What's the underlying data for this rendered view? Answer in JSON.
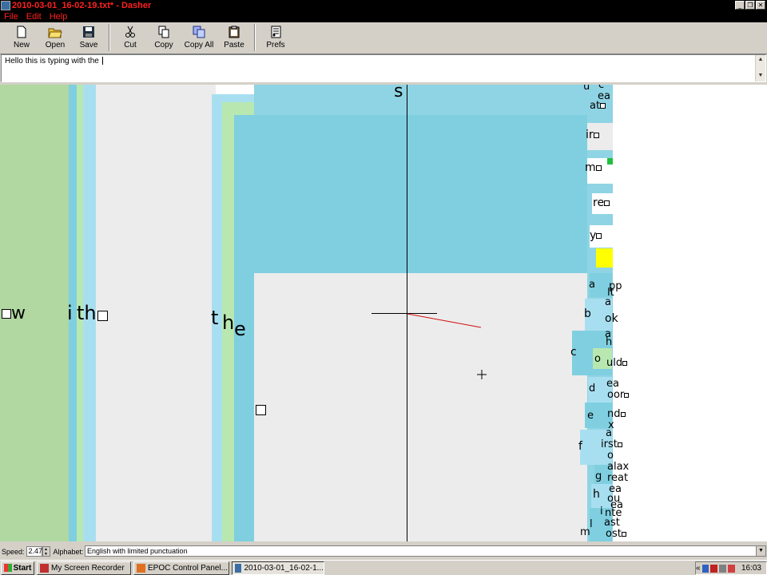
{
  "window": {
    "title": "2010-03-01_16-02-19.txt* - Dasher"
  },
  "menu": [
    "File",
    "Edit",
    "Help"
  ],
  "toolbar": {
    "new": "New",
    "open": "Open",
    "save": "Save",
    "cut": "Cut",
    "copy": "Copy",
    "copy_all": "Copy All",
    "paste": "Paste",
    "prefs": "Prefs"
  },
  "editor": {
    "text": "Hello this is typing with the "
  },
  "canvas_glyphs": {
    "w": "w",
    "ith": "ith",
    "i": "i",
    "th": "th",
    "t": "t",
    "h": "h",
    "e": "e",
    "s": "s",
    "u": "u",
    "c": "c",
    "ea": "ea",
    "at": "at",
    "ir": "ir",
    "m": "m",
    "re": "re",
    "y": "y",
    "a": "a",
    "pp": "pp",
    "lt": "lt",
    "b": "b",
    "ok": "ok",
    "cc": "c",
    "o": "o",
    "uld": "uld",
    "d": "d",
    "oor": "oor",
    "ee": "e",
    "nd": "nd",
    "x": "x",
    "f": "f",
    "irst": "irst",
    "g": "g",
    "alax": "alax",
    "reat": "reat",
    "hh": "h",
    "ou": "ou",
    "ea2": "ea",
    "nte": "nte",
    "l": "l",
    "ast": "ast",
    "mm": "m",
    "ost": "ost"
  },
  "statusbar": {
    "speed_label": "Speed:",
    "speed_value": "2.47",
    "alphabet_label": "Alphabet:",
    "alphabet_value": "English with limited punctuation"
  },
  "taskbar": {
    "start": "Start",
    "tasks": [
      "My Screen Recorder",
      "EPOC Control Panel...",
      "2010-03-01_16-02-1..."
    ],
    "clock": "16:03",
    "tray_chevron": "«"
  },
  "colors": {
    "green": "#b0d8a0",
    "cyan": "#7fcfe0",
    "light": "#ececec",
    "accent_red": "#ff2020",
    "yellow": "#ffff00"
  }
}
